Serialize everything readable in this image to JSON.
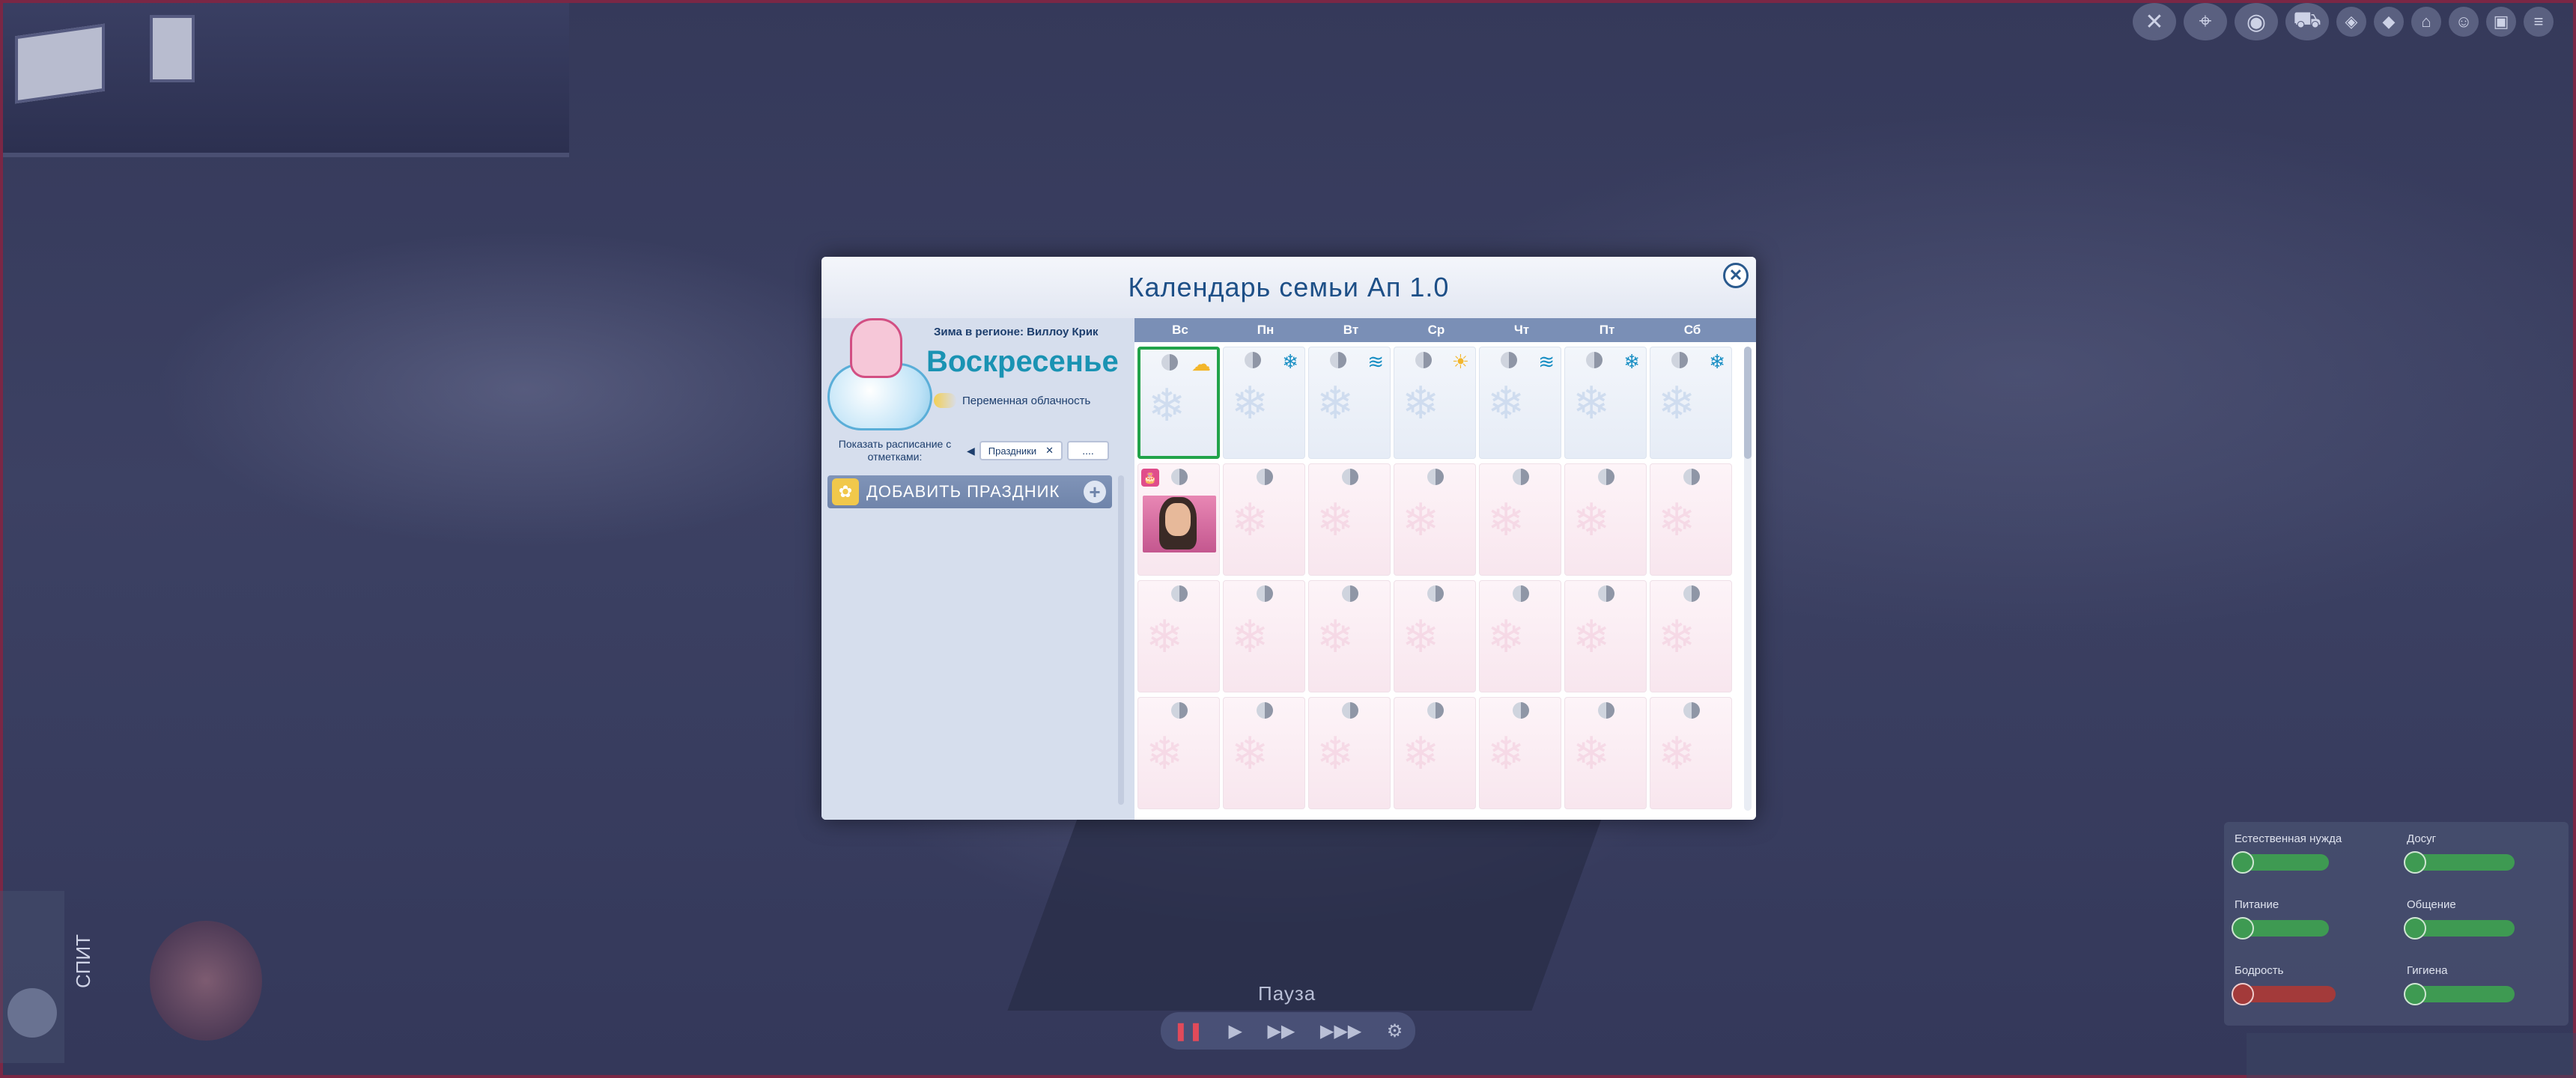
{
  "modal": {
    "title": "Календарь семьи Ап 1.0",
    "region": "Зима в регионе: Виллоу Крик",
    "day_name": "Воскресенье",
    "weather": "Переменная облачность",
    "schedule_label": "Показать расписание с отметками:",
    "filter": "Праздники",
    "more": "....",
    "add_holiday": "ДОБАВИТЬ ПРАЗДНИК",
    "weekdays": [
      "Вс",
      "Пн",
      "Вт",
      "Ср",
      "Чт",
      "Пт",
      "Сб"
    ],
    "week1_weather": [
      "cloudy-sun",
      "snow",
      "wind",
      "sun",
      "wind",
      "snow",
      "snow"
    ]
  },
  "hud": {
    "pause": "Пауза",
    "sleep_status": "СПИТ",
    "needs": [
      {
        "label": "Естественная нужда",
        "level": 0.7,
        "status": "green"
      },
      {
        "label": "Досуг",
        "level": 0.8,
        "status": "green"
      },
      {
        "label": "Питание",
        "level": 0.7,
        "status": "green"
      },
      {
        "label": "Общение",
        "level": 0.8,
        "status": "green"
      },
      {
        "label": "Бодрость",
        "level": 0.75,
        "status": "red"
      },
      {
        "label": "Гигиена",
        "level": 0.8,
        "status": "green"
      }
    ]
  },
  "colors": {
    "accent_blue": "#1d4f87",
    "day_name": "#1a93b3",
    "today_border": "#22a34a",
    "header_strip": "#7a8fb6"
  },
  "icons": {
    "close": "close-icon",
    "add": "plus-icon",
    "flower": "flower-icon",
    "cake": "birthday-cake-icon"
  }
}
